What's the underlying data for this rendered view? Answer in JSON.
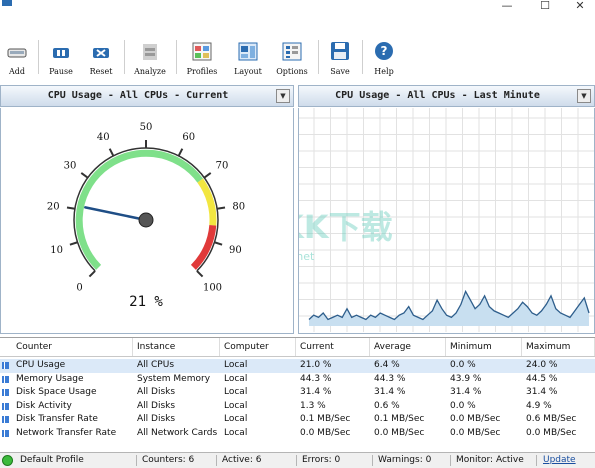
{
  "window": {
    "minimize": "—",
    "maximize": "☐",
    "close": "✕"
  },
  "toolbar": {
    "add": "Add",
    "pause": "Pause",
    "reset": "Reset",
    "analyze": "Analyze",
    "profiles": "Profiles",
    "layout": "Layout",
    "options": "Options",
    "save": "Save",
    "help": "Help"
  },
  "left_panel": {
    "title": "CPU Usage - All CPUs - Current"
  },
  "right_panel": {
    "title": "CPU Usage - All CPUs - Last Minute"
  },
  "gauge": {
    "ticks": [
      "0",
      "10",
      "20",
      "30",
      "40",
      "50",
      "60",
      "70",
      "80",
      "90",
      "100"
    ],
    "readout": "21 %",
    "value_percent": 21
  },
  "graph": {
    "values": [
      3,
      5,
      4,
      6,
      3,
      4,
      5,
      4,
      8,
      4,
      5,
      4,
      3,
      5,
      4,
      6,
      5,
      4,
      3,
      5,
      6,
      9,
      5,
      4,
      3,
      5,
      7,
      12,
      8,
      5,
      4,
      6,
      10,
      16,
      12,
      8,
      10,
      14,
      9,
      7,
      6,
      5,
      4,
      6,
      8,
      11,
      9,
      6,
      5,
      7,
      10,
      14,
      8,
      6,
      5,
      4,
      7,
      10,
      13,
      6
    ]
  },
  "watermark": {
    "main": "KK下载",
    "url": "www.kkx.net"
  },
  "table": {
    "headers": [
      "Counter",
      "Instance",
      "Computer",
      "Current",
      "Average",
      "Minimum",
      "Maximum"
    ],
    "rows": [
      {
        "counter": "CPU Usage",
        "instance": "All CPUs",
        "computer": "Local",
        "current": "21.0 %",
        "average": "6.4 %",
        "minimum": "0.0 %",
        "maximum": "24.0 %"
      },
      {
        "counter": "Memory Usage",
        "instance": "System Memory",
        "computer": "Local",
        "current": "44.3 %",
        "average": "44.3 %",
        "minimum": "43.9 %",
        "maximum": "44.5 %"
      },
      {
        "counter": "Disk Space Usage",
        "instance": "All Disks",
        "computer": "Local",
        "current": "31.4 %",
        "average": "31.4 %",
        "minimum": "31.4 %",
        "maximum": "31.4 %"
      },
      {
        "counter": "Disk Activity",
        "instance": "All Disks",
        "computer": "Local",
        "current": "1.3 %",
        "average": "0.6 %",
        "minimum": "0.0 %",
        "maximum": "4.9 %"
      },
      {
        "counter": "Disk Transfer Rate",
        "instance": "All Disks",
        "computer": "Local",
        "current": "0.1 MB/Sec",
        "average": "0.1 MB/Sec",
        "minimum": "0.0 MB/Sec",
        "maximum": "0.6 MB/Sec"
      },
      {
        "counter": "Network Transfer Rate",
        "instance": "All Network Cards",
        "computer": "Local",
        "current": "0.0 MB/Sec",
        "average": "0.0 MB/Sec",
        "minimum": "0.0 MB/Sec",
        "maximum": "0.0 MB/Sec"
      }
    ]
  },
  "status": {
    "profile": "Default Profile",
    "counters": "Counters: 6",
    "active": "Active: 6",
    "errors": "Errors: 0",
    "warnings": "Warnings: 0",
    "monitor": "Monitor: Active",
    "update": "Update"
  },
  "colors": {
    "accent": "#2b6cb0",
    "gauge_green": "#7fe08a",
    "gauge_yellow": "#f2e640",
    "gauge_red": "#e03a3a",
    "graph_fill": "#c8dff0",
    "graph_line": "#2e5e8c"
  }
}
